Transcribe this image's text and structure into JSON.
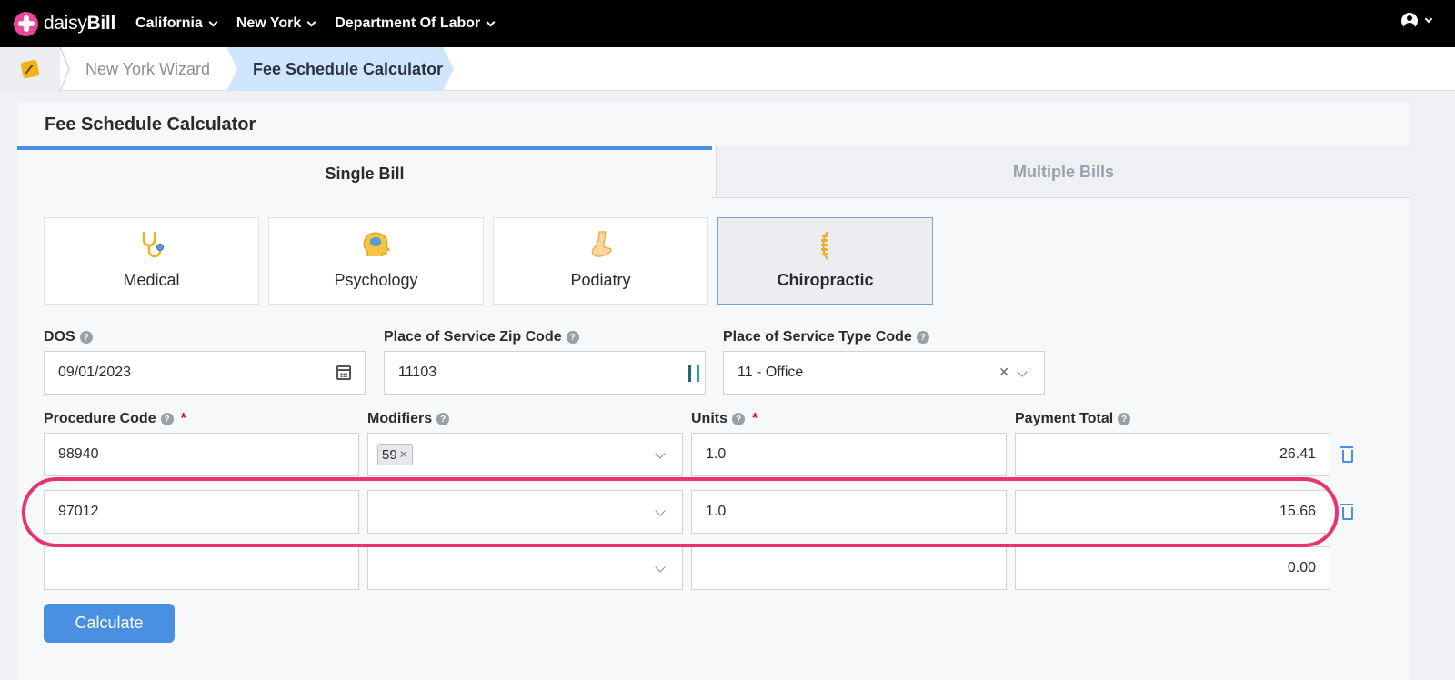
{
  "brand": {
    "name_light": "daisy",
    "name_bold": "Bill",
    "accent": "#e8489b"
  },
  "nav": {
    "items": [
      {
        "label": "California"
      },
      {
        "label": "New York"
      },
      {
        "label": "Department Of Labor"
      }
    ]
  },
  "breadcrumb": {
    "wizard": "New York Wizard",
    "current": "Fee Schedule Calculator"
  },
  "card": {
    "title": "Fee Schedule Calculator"
  },
  "tabs": {
    "single": "Single Bill",
    "multiple": "Multiple Bills",
    "active": "Single Bill"
  },
  "specialties": [
    {
      "label": "Medical",
      "icon": "stethoscope-icon"
    },
    {
      "label": "Psychology",
      "icon": "brain-icon"
    },
    {
      "label": "Podiatry",
      "icon": "foot-icon"
    },
    {
      "label": "Chiropractic",
      "icon": "spine-icon",
      "selected": true
    }
  ],
  "form": {
    "dos": {
      "label": "DOS",
      "value": "09/01/2023"
    },
    "zip": {
      "label": "Place of Service Zip Code",
      "value": "11103"
    },
    "pos_type": {
      "label": "Place of Service Type Code",
      "value": "11 - Office"
    }
  },
  "table": {
    "headers": {
      "procedure": "Procedure Code",
      "modifiers": "Modifiers",
      "units": "Units",
      "payment": "Payment Total"
    },
    "rows": [
      {
        "procedure": "98940",
        "modifier": "59",
        "units": "1.0",
        "payment": "26.41"
      },
      {
        "procedure": "97012",
        "modifier": "",
        "units": "1.0",
        "payment": "15.66"
      },
      {
        "procedure": "",
        "modifier": "",
        "units": "",
        "payment": "0.00"
      }
    ]
  },
  "actions": {
    "calculate": "Calculate"
  },
  "colors": {
    "primary": "#4a90e2",
    "highlight": "#e8336c",
    "required": "#d0021b"
  }
}
